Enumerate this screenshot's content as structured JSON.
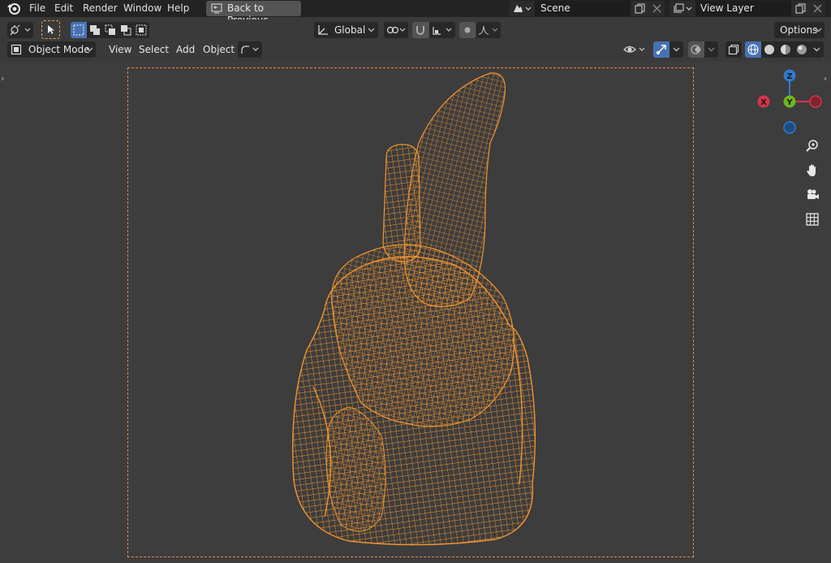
{
  "menu": {
    "items": [
      "File",
      "Edit",
      "Render",
      "Window",
      "Help"
    ],
    "back_button": "Back to Previous"
  },
  "scene": {
    "label": "Scene"
  },
  "view_layer": {
    "label": "View Layer"
  },
  "tool_header": {
    "transform_orientation": "Global",
    "options_label": "Options"
  },
  "viewport_header": {
    "mode": "Object Mode",
    "menus": [
      "View",
      "Select",
      "Add",
      "Object"
    ]
  },
  "gizmo": {
    "z": "Z",
    "y": "Y",
    "x": "X"
  },
  "colors": {
    "accent": "#4772b3",
    "wire": "#f0942f",
    "camera_frame": "#e8864a",
    "axis_x": "#d6344a",
    "axis_y": "#6fb51c",
    "axis_z": "#2e7bd1"
  },
  "icons": [
    "blender-logo-icon",
    "back-icon",
    "scene-icon",
    "view-layer-icon",
    "copy-icon",
    "close-icon",
    "editor-type-icon",
    "select-tool-icon",
    "select-mode-icons",
    "transform-orientation-icon",
    "pivot-icon",
    "snap-icon",
    "proportional-icon",
    "visibility-icon",
    "gizmo-icon",
    "overlay-icon",
    "xray-icon",
    "shading-icons",
    "zoom-icon",
    "hand-icon",
    "camera-icon",
    "grid-icon"
  ]
}
